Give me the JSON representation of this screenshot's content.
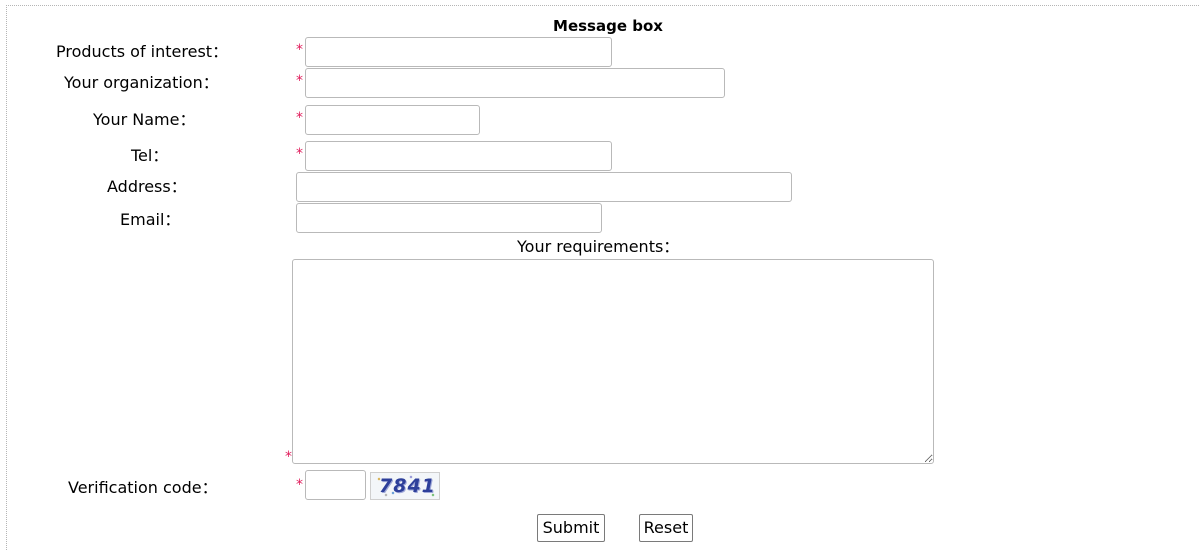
{
  "form": {
    "title": "Message box",
    "required_mark": "*",
    "fields": {
      "products": {
        "label": "Products of interest：",
        "value": ""
      },
      "organization": {
        "label": "Your organization：",
        "value": ""
      },
      "name": {
        "label": "Your Name：",
        "value": ""
      },
      "tel": {
        "label": "Tel：",
        "value": ""
      },
      "address": {
        "label": "Address：",
        "value": ""
      },
      "email": {
        "label": "Email：",
        "value": ""
      },
      "requirements": {
        "label": "Your requirements：",
        "value": ""
      },
      "verification": {
        "label": "Verification code：",
        "value": ""
      }
    },
    "captcha_text": "7841",
    "buttons": {
      "submit_label": "Submit",
      "reset_label": "Reset"
    }
  },
  "colors": {
    "required_mark": "#e01a5a",
    "field_border": "#b9b9b9",
    "page_background": "#ffffff"
  }
}
